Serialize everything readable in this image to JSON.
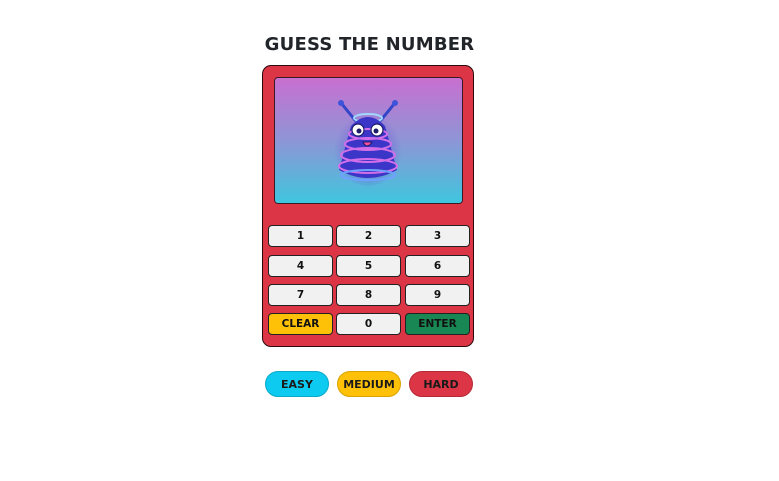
{
  "title": "GUESS THE NUMBER",
  "keypad": {
    "keys": [
      "1",
      "2",
      "3",
      "4",
      "5",
      "6",
      "7",
      "8",
      "9"
    ],
    "clear_label": "CLEAR",
    "zero_label": "0",
    "enter_label": "ENTER"
  },
  "levels": {
    "easy_label": "EASY",
    "medium_label": "MEDIUM",
    "hard_label": "HARD"
  },
  "colors": {
    "device": "#dc3545",
    "clear": "#ffc107",
    "enter": "#198754",
    "easy": "#0dcaf0",
    "medium": "#ffc107",
    "hard": "#dc3545",
    "screen_top": "#c86fd0",
    "screen_bottom": "#3fc6de"
  },
  "screen": {
    "image_icon": "spring-alien-mascot-icon"
  }
}
